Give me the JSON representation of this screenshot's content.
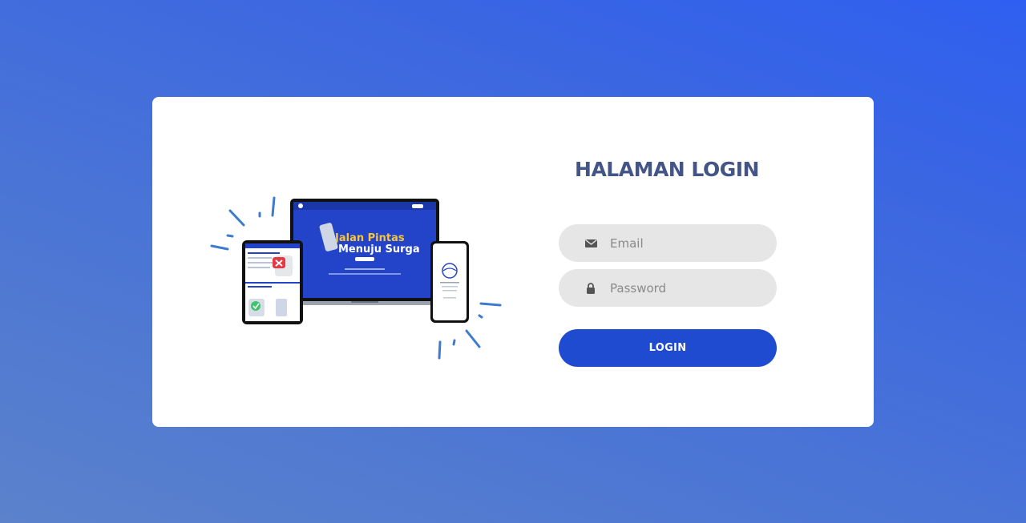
{
  "login": {
    "title": "HALAMAN LOGIN",
    "email": {
      "placeholder": "Email",
      "value": "",
      "icon": "envelope-icon"
    },
    "password": {
      "placeholder": "Password",
      "value": "",
      "icon": "lock-icon"
    },
    "button_label": "LOGIN"
  },
  "illustration": {
    "icon": "devices-mockup-image",
    "laptop_screen": {
      "line1": "Jalan Pintas",
      "line2": "Menuju Surga"
    }
  },
  "colors": {
    "title": "#435486",
    "button": "#1f4bd1",
    "field_bg": "#e6e6e6",
    "background_start": "#5b82cb",
    "background_end": "#2f5ff0"
  }
}
